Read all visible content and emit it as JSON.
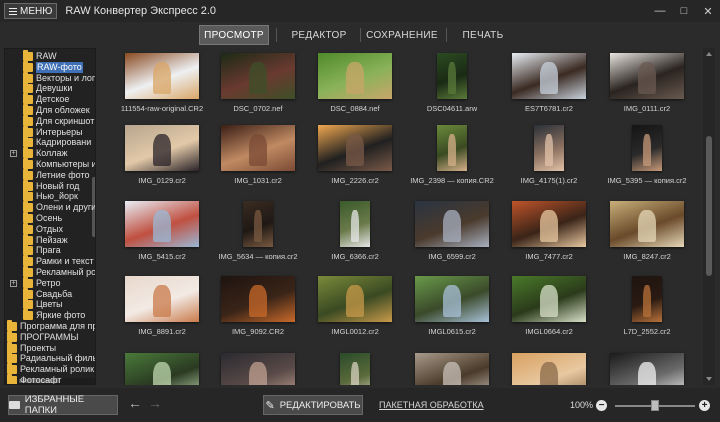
{
  "app": {
    "menu_label": "МЕНЮ",
    "title": "RAW Конвертер Экспресс 2.0",
    "window_controls": [
      "minimize-icon",
      "maximize-icon",
      "close-icon"
    ]
  },
  "tabs": [
    {
      "label": "ПРОСМОТР",
      "active": true
    },
    {
      "label": "РЕДАКТОР",
      "active": false
    },
    {
      "label": "СОХРАНЕНИЕ",
      "active": false
    },
    {
      "label": "ПЕЧАТЬ",
      "active": false
    }
  ],
  "folders": [
    {
      "label": "RAW",
      "level": 1,
      "selected": false
    },
    {
      "label": "RAW-фото",
      "level": 1,
      "selected": true
    },
    {
      "label": "Векторы и лог",
      "level": 1,
      "selected": false
    },
    {
      "label": "Девушки",
      "level": 1,
      "selected": false
    },
    {
      "label": "Детское",
      "level": 1,
      "selected": false
    },
    {
      "label": "Для обложек",
      "level": 1,
      "selected": false
    },
    {
      "label": "Для скриншот",
      "level": 1,
      "selected": false
    },
    {
      "label": "Интерьеры",
      "level": 1,
      "selected": false
    },
    {
      "label": "Кадрировани",
      "level": 1,
      "selected": false
    },
    {
      "label": "Коллаж",
      "level": 1,
      "selected": false,
      "expander": "+"
    },
    {
      "label": "Компьютеры и",
      "level": 1,
      "selected": false
    },
    {
      "label": "Летние фото",
      "level": 1,
      "selected": false
    },
    {
      "label": "Новый год",
      "level": 1,
      "selected": false
    },
    {
      "label": "Нью_йорк",
      "level": 1,
      "selected": false
    },
    {
      "label": "Олени и други",
      "level": 1,
      "selected": false
    },
    {
      "label": "Осень",
      "level": 1,
      "selected": false
    },
    {
      "label": "Отдых",
      "level": 1,
      "selected": false
    },
    {
      "label": "Пейзаж",
      "level": 1,
      "selected": false
    },
    {
      "label": "Прага",
      "level": 1,
      "selected": false
    },
    {
      "label": "Рамки и текст",
      "level": 1,
      "selected": false
    },
    {
      "label": "Рекламный ро",
      "level": 1,
      "selected": false
    },
    {
      "label": "Ретро",
      "level": 1,
      "selected": false,
      "expander": "+"
    },
    {
      "label": "Свадьба",
      "level": 1,
      "selected": false
    },
    {
      "label": "Цветы",
      "level": 1,
      "selected": false
    },
    {
      "label": "Яркие фото",
      "level": 1,
      "selected": false
    },
    {
      "label": "Программа для про",
      "level": 0,
      "selected": false
    },
    {
      "label": "ПРОГРАММЫ",
      "level": 0,
      "selected": false
    },
    {
      "label": "Проекты",
      "level": 0,
      "selected": false
    },
    {
      "label": "Радиальный фильт",
      "level": 0,
      "selected": false
    },
    {
      "label": "Рекламный ролик",
      "level": 0,
      "selected": false
    },
    {
      "label": "Фотосафт",
      "level": 0,
      "selected": false
    }
  ],
  "photos": [
    {
      "name": "111554-raw-original.CR2",
      "orientation": "landscape",
      "colors": [
        "#8a4a22",
        "#d9a566",
        "#eef0f2"
      ]
    },
    {
      "name": "DSC_0702.nef",
      "orientation": "landscape",
      "colors": [
        "#1d2a16",
        "#3e4f28",
        "#6a3a30"
      ]
    },
    {
      "name": "DSC_0884.nef",
      "orientation": "landscape",
      "colors": [
        "#4f8a2a",
        "#c9a56a",
        "#8ab25a"
      ]
    },
    {
      "name": "DSC04611.arw",
      "orientation": "portrait",
      "colors": [
        "#2c4a22",
        "#5b7a3a",
        "#1a2a14"
      ]
    },
    {
      "name": "ES7T6781.cr2",
      "orientation": "landscape",
      "colors": [
        "#e9eef4",
        "#c8d2dc",
        "#3a2a22"
      ]
    },
    {
      "name": "IMG_0111.cr2",
      "orientation": "landscape",
      "colors": [
        "#e8e4df",
        "#6a5a50",
        "#2a2420"
      ]
    },
    {
      "name": "IMG_0129.cr2",
      "orientation": "landscape",
      "colors": [
        "#b7a58e",
        "#2a2228",
        "#e2c9a8"
      ]
    },
    {
      "name": "IMG_1031.cr2",
      "orientation": "landscape",
      "colors": [
        "#3a1e16",
        "#7a4a34",
        "#c08a62"
      ]
    },
    {
      "name": "IMG_2226.cr2",
      "orientation": "landscape",
      "colors": [
        "#f0a850",
        "#7a5a48",
        "#202020"
      ]
    },
    {
      "name": "IMG_2398 — копия.CR2",
      "orientation": "portrait",
      "colors": [
        "#6a8a3a",
        "#d6b08a",
        "#3a4a22"
      ]
    },
    {
      "name": "IMG_4175(1).cr2",
      "orientation": "portrait",
      "colors": [
        "#2a3038",
        "#e2c2a8",
        "#8a7060"
      ]
    },
    {
      "name": "IMG_5395 — копия.cr2",
      "orientation": "portrait",
      "colors": [
        "#141414",
        "#c89a7a",
        "#2a2a2a"
      ]
    },
    {
      "name": "IMG_5415.cr2",
      "orientation": "landscape",
      "colors": [
        "#e8eef6",
        "#9ab8d6",
        "#c05040"
      ]
    },
    {
      "name": "IMG_5634 — копия.cr2",
      "orientation": "portrait",
      "colors": [
        "#3a2c22",
        "#7a5a40",
        "#1e1814"
      ]
    },
    {
      "name": "IMG_6366.cr2",
      "orientation": "portrait",
      "colors": [
        "#3a5a2a",
        "#e6e6e6",
        "#6a7a4a"
      ]
    },
    {
      "name": "IMG_6599.cr2",
      "orientation": "landscape",
      "colors": [
        "#2a3442",
        "#a8b0c0",
        "#4a3a2c"
      ]
    },
    {
      "name": "IMG_7477.cr2",
      "orientation": "landscape",
      "colors": [
        "#c0542a",
        "#e8c8a0",
        "#3a2418"
      ]
    },
    {
      "name": "IMG_8247.cr2",
      "orientation": "landscape",
      "colors": [
        "#c8b07a",
        "#e6d8b8",
        "#6a4a2a"
      ]
    },
    {
      "name": "IMG_8891.cr2",
      "orientation": "landscape",
      "colors": [
        "#e8d8cc",
        "#c97a4a",
        "#f2eae4"
      ]
    },
    {
      "name": "IMG_9092.CR2",
      "orientation": "landscape",
      "colors": [
        "#1e1410",
        "#c86a2a",
        "#3a2418"
      ]
    },
    {
      "name": "IMGL0012.cr2",
      "orientation": "landscape",
      "colors": [
        "#7a8a3a",
        "#c89a4a",
        "#3a4a22"
      ]
    },
    {
      "name": "IMGL0615.cr2",
      "orientation": "landscape",
      "colors": [
        "#6a9a4a",
        "#a8c0d8",
        "#3a4a2a"
      ]
    },
    {
      "name": "IMGL0664.cr2",
      "orientation": "landscape",
      "colors": [
        "#4a7a2a",
        "#d8e0c8",
        "#2a3a1a"
      ]
    },
    {
      "name": "L7D_2552.cr2",
      "orientation": "portrait",
      "colors": [
        "#1e1410",
        "#b8723a",
        "#2a1a12"
      ]
    },
    {
      "name": "",
      "orientation": "landscape",
      "colors": [
        "#4a7a3a",
        "#c0d8b0",
        "#2a3a22"
      ]
    },
    {
      "name": "",
      "orientation": "landscape",
      "colors": [
        "#2a2a30",
        "#c0a090",
        "#5a4a48"
      ]
    },
    {
      "name": "",
      "orientation": "portrait",
      "colors": [
        "#2a4a2a",
        "#d8d0c0",
        "#5a6a3a"
      ]
    },
    {
      "name": "",
      "orientation": "landscape",
      "colors": [
        "#a89a8a",
        "#c8c0b8",
        "#4a3a2a"
      ]
    },
    {
      "name": "",
      "orientation": "landscape",
      "colors": [
        "#d8a060",
        "#8a6a4a",
        "#e8c8a0"
      ]
    },
    {
      "name": "",
      "orientation": "landscape",
      "colors": [
        "#1a1a1a",
        "#f2f2f2",
        "#6a6a6a"
      ]
    }
  ],
  "bottom": {
    "favorites_label": "ИЗБРАННЫЕ ПАПКИ",
    "edit_label": "РЕДАКТИРОВАТЬ",
    "batch_label": "ПАКЕТНАЯ ОБРАБОТКА",
    "zoom_label": "100%",
    "zoom_minus": "−",
    "zoom_plus": "+",
    "zoom_level": 0.5
  }
}
